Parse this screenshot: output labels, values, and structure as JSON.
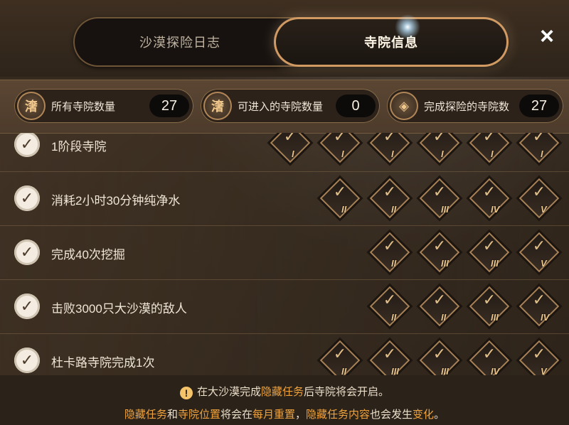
{
  "tabs": [
    {
      "label": "沙漠探险日志",
      "active": false
    },
    {
      "label": "寺院信息",
      "active": true
    }
  ],
  "close_icon": "×",
  "stats": [
    {
      "icon": "temple-icon",
      "glyph": "㵔",
      "label": "所有寺院数量",
      "value": "27"
    },
    {
      "icon": "temple-enter-icon",
      "glyph": "㵔",
      "label": "可进入的寺院数量",
      "value": "0"
    },
    {
      "icon": "compass-icon",
      "glyph": "◈",
      "label": "完成探险的寺院数",
      "value": "27"
    }
  ],
  "conditions": [
    {
      "label": "1阶段寺院",
      "badges": [
        "I",
        "I",
        "I",
        "I",
        "I",
        "I"
      ]
    },
    {
      "label": "消耗2小时30分钟纯净水",
      "badges": [
        "II",
        "II",
        "III",
        "IV",
        "V"
      ]
    },
    {
      "label": "完成40次挖掘",
      "badges": [
        "II",
        "III",
        "III",
        "V"
      ]
    },
    {
      "label": "击败3000只大沙漠的敌人",
      "badges": [
        "II",
        "II",
        "III",
        "IV"
      ]
    },
    {
      "label": "杜卡路寺院完成1次",
      "badges": [
        "II",
        "III",
        "III",
        "IV",
        "V"
      ]
    }
  ],
  "check_glyph": "✓",
  "badge_mark": "✓",
  "footer": {
    "warn_glyph": "!",
    "line1": [
      "在大沙漠完成",
      "隐藏任务",
      "后寺院将会开启。"
    ],
    "line2": [
      "隐藏任务",
      "和",
      "寺院位置",
      "将会在",
      "每月重置",
      "，",
      "隐藏任务内容",
      "也会发生",
      "变化",
      "。"
    ]
  },
  "colors": {
    "accent": "#d19a63",
    "highlight": "#f0a33c"
  }
}
